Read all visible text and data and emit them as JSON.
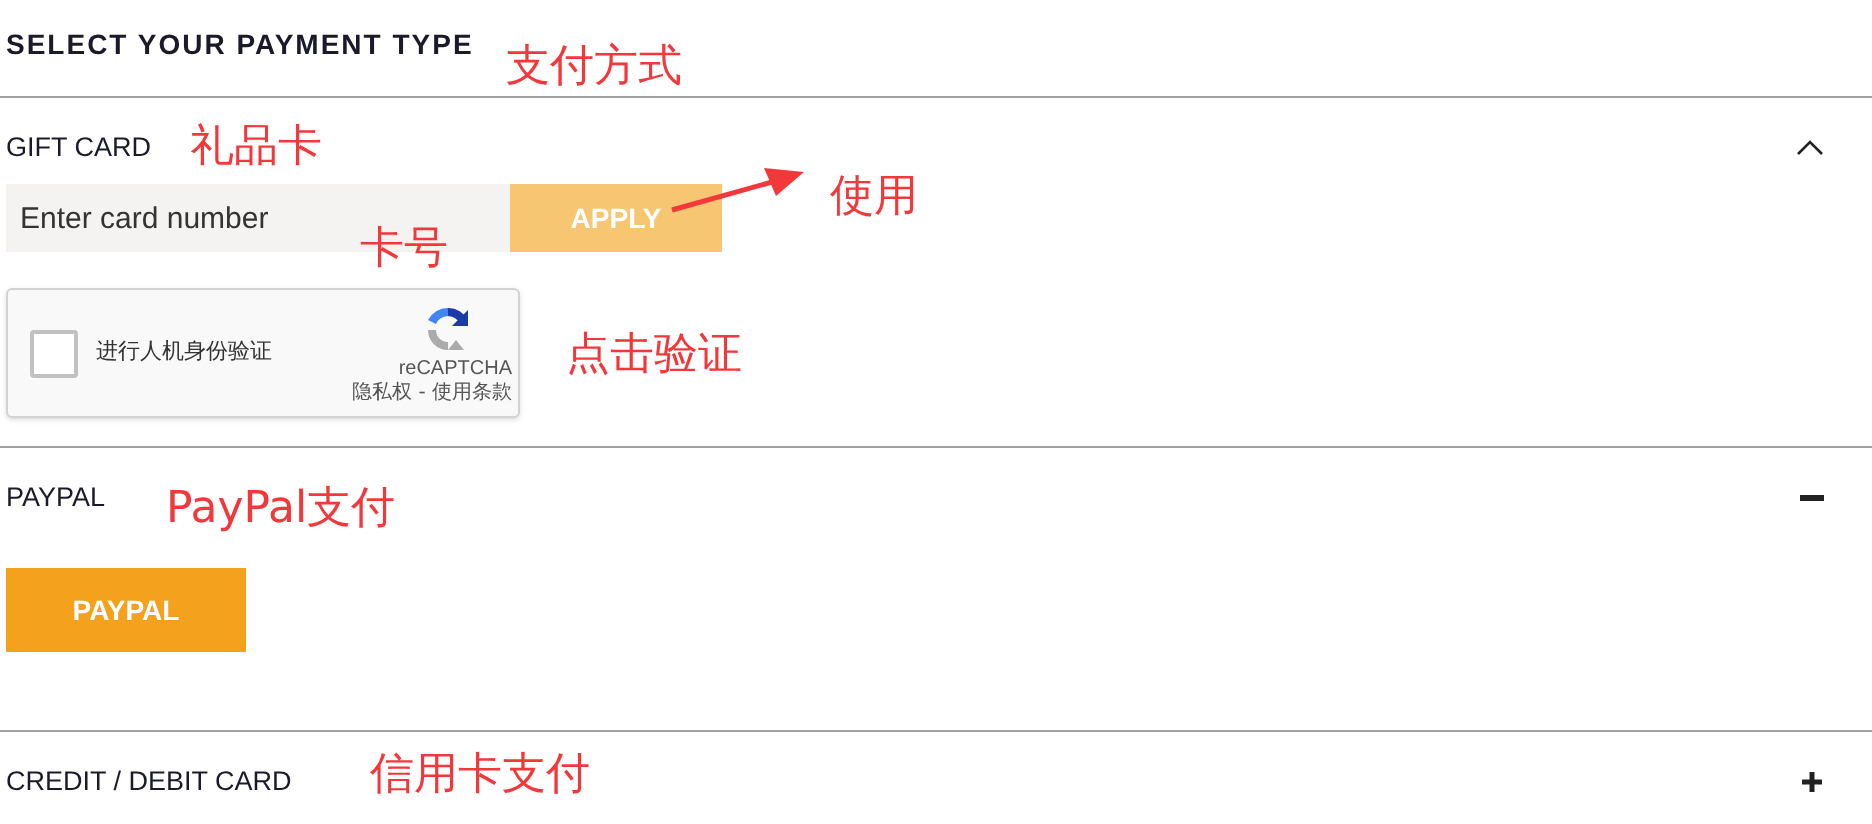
{
  "title": "SELECT YOUR PAYMENT TYPE",
  "sections": [
    {
      "kind": "gift_card",
      "label": "GIFT CARD",
      "expanded": true,
      "field": {
        "placeholder": "Enter card number"
      },
      "button": {
        "label": "APPLY",
        "disabled": true
      },
      "captcha": {
        "label": "进行人机身份验证",
        "checked": false,
        "brand": "reCAPTCHA",
        "links": "隐私权 - 使用条款"
      }
    },
    {
      "kind": "paypal",
      "label": "PAYPAL",
      "expanded": true,
      "button": {
        "label": "PAYPAL",
        "disabled": false
      }
    },
    {
      "label": "CREDIT / DEBIT CARD",
      "expanded": false
    }
  ],
  "annotations": [
    {
      "text": "支付方式"
    },
    {
      "text": "礼品卡"
    },
    {
      "text": "卡号"
    },
    {
      "text": "使用"
    },
    {
      "text": "点击验证"
    },
    {
      "text": "PayPal支付"
    },
    {
      "text": "信用卡支付"
    }
  ]
}
